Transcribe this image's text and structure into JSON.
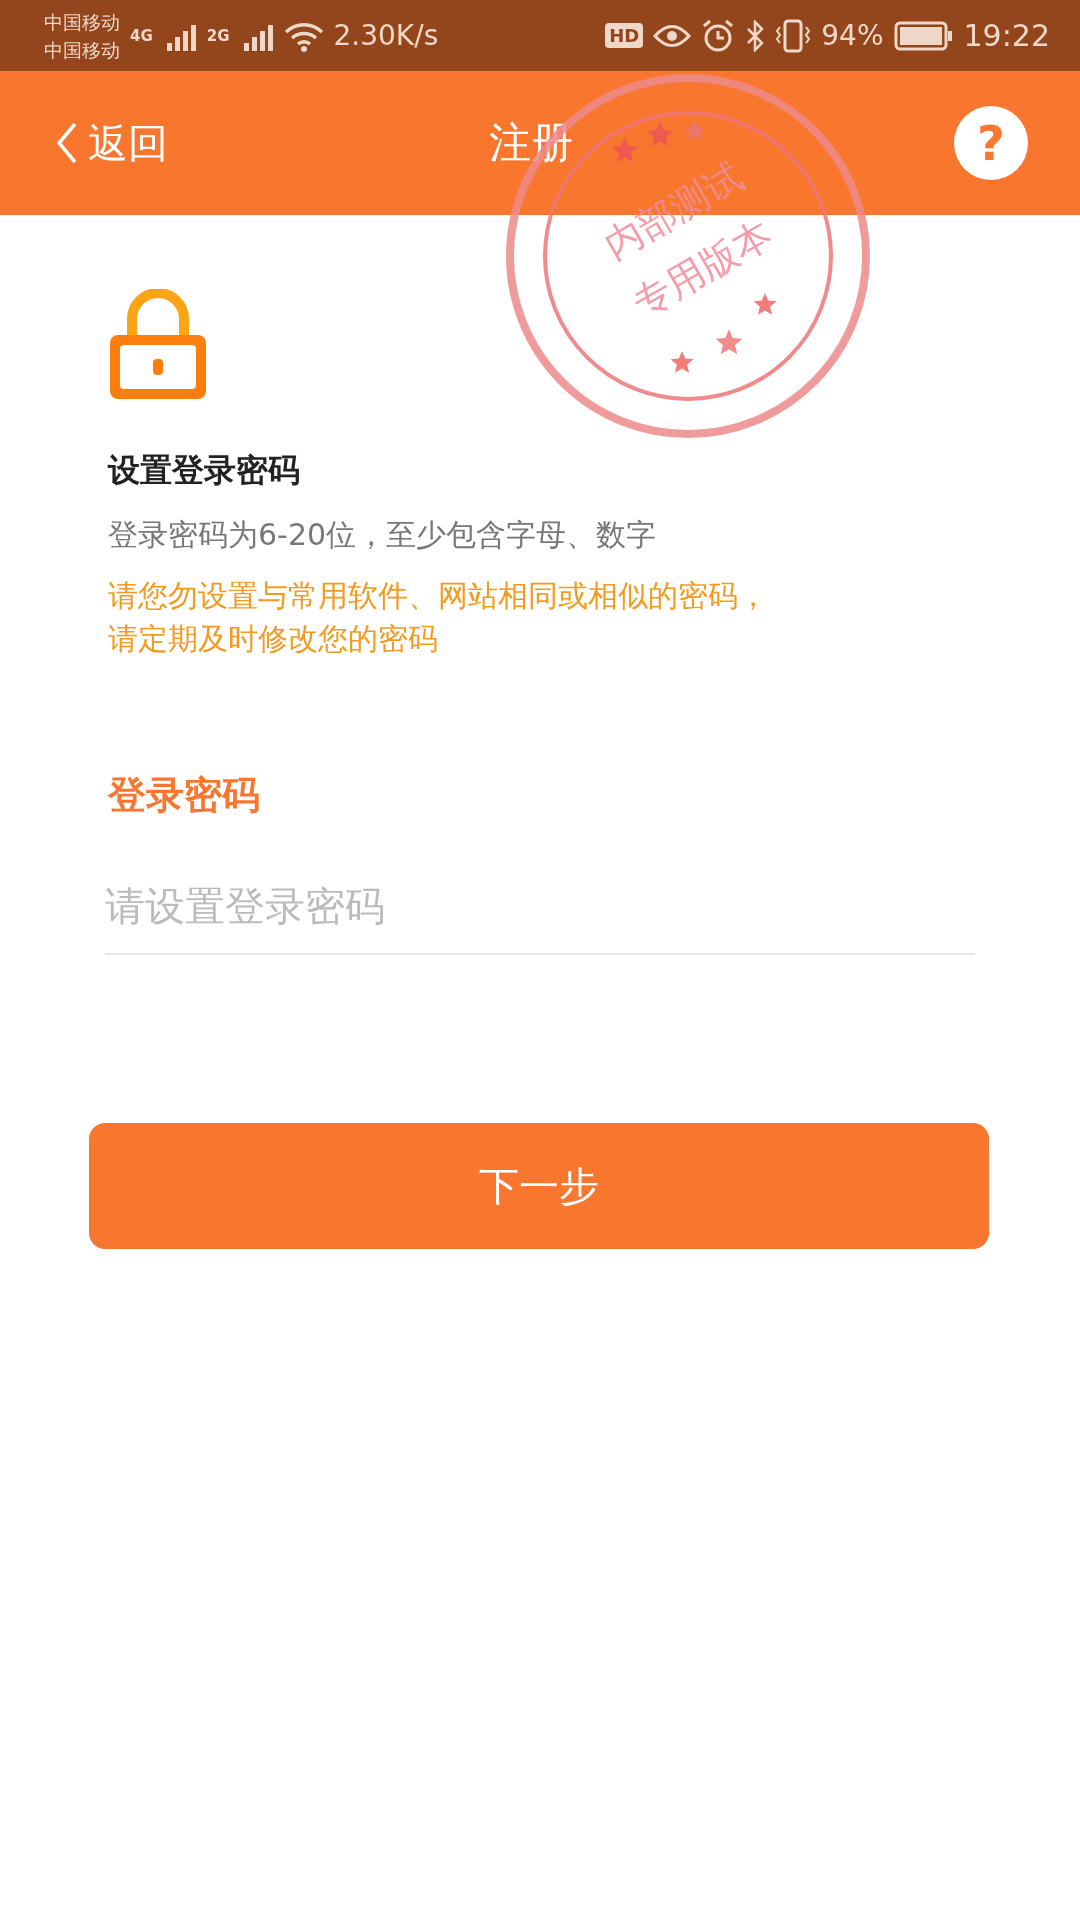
{
  "status_bar": {
    "carriers": [
      "中国移动",
      "中国移动"
    ],
    "networks": [
      "4G",
      "2G"
    ],
    "speed": "2.30K/s",
    "hd": "HD",
    "battery": "94%",
    "time": "19:22"
  },
  "header": {
    "back": "返回",
    "title": "注册",
    "help": "?"
  },
  "stamp": {
    "lines": [
      "内部测试",
      "专用版本"
    ]
  },
  "section": {
    "title": "设置登录密码",
    "description": "登录密码为6-20位，至少包含字母、数字",
    "warning": [
      "请您勿设置与常用软件、网站相同或相似的密码，",
      "请定期及时修改您的密码"
    ]
  },
  "field": {
    "label": "登录密码",
    "placeholder": "请设置登录密码"
  },
  "next_button": "下一步"
}
